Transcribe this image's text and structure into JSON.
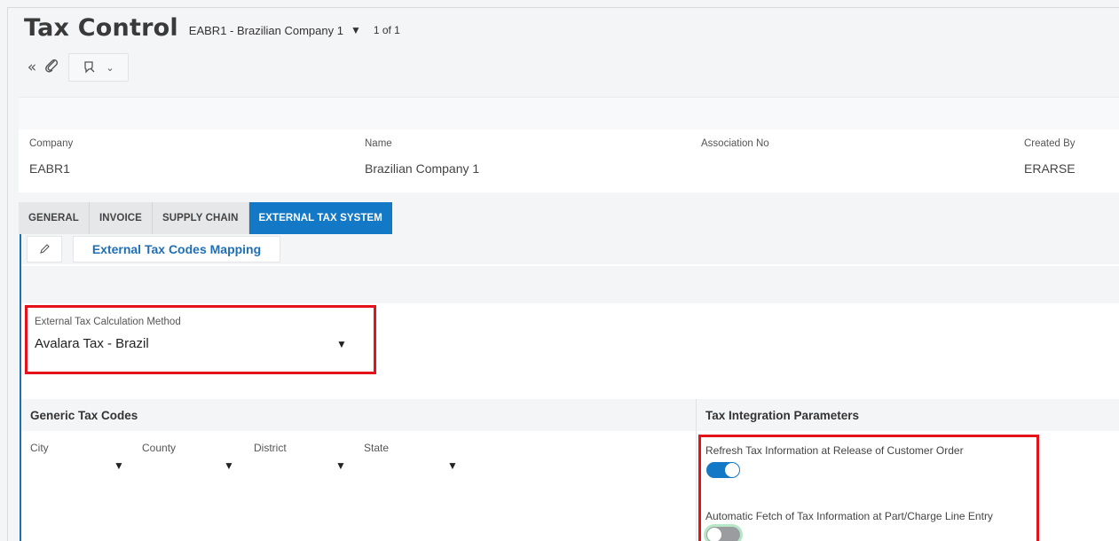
{
  "header": {
    "title": "Tax Control",
    "record_selector": "EABR1 - Brazilian Company 1",
    "record_count": "1 of 1"
  },
  "toolbar": {
    "collapse_icon": "double-chevron-left-icon",
    "attach_icon": "paperclip-icon",
    "assist_icon": "assistant-icon"
  },
  "record": {
    "fields": [
      {
        "label": "Company",
        "value": "EABR1"
      },
      {
        "label": "Name",
        "value": "Brazilian Company 1"
      },
      {
        "label": "Association No",
        "value": ""
      },
      {
        "label": "Created By",
        "value": "ERARSE"
      }
    ]
  },
  "tabs": [
    {
      "label": "GENERAL",
      "active": false
    },
    {
      "label": "INVOICE",
      "active": false
    },
    {
      "label": "SUPPLY CHAIN",
      "active": false
    },
    {
      "label": "EXTERNAL TAX SYSTEM",
      "active": true
    }
  ],
  "content": {
    "edit_icon": "pencil-icon",
    "mapping_button": "External Tax Codes Mapping",
    "method": {
      "label": "External Tax Calculation Method",
      "value": "Avalara Tax - Brazil"
    },
    "generic": {
      "title": "Generic Tax Codes",
      "fields": [
        "City",
        "County",
        "District",
        "State"
      ]
    },
    "params": {
      "title": "Tax Integration Parameters",
      "items": [
        {
          "label": "Refresh Tax Information at Release of Customer Order",
          "on": true
        },
        {
          "label": "Automatic Fetch of Tax Information at Part/Charge Line Entry",
          "on": false
        }
      ]
    }
  },
  "colors": {
    "accent": "#1378c6",
    "highlight": "#e4121b"
  }
}
